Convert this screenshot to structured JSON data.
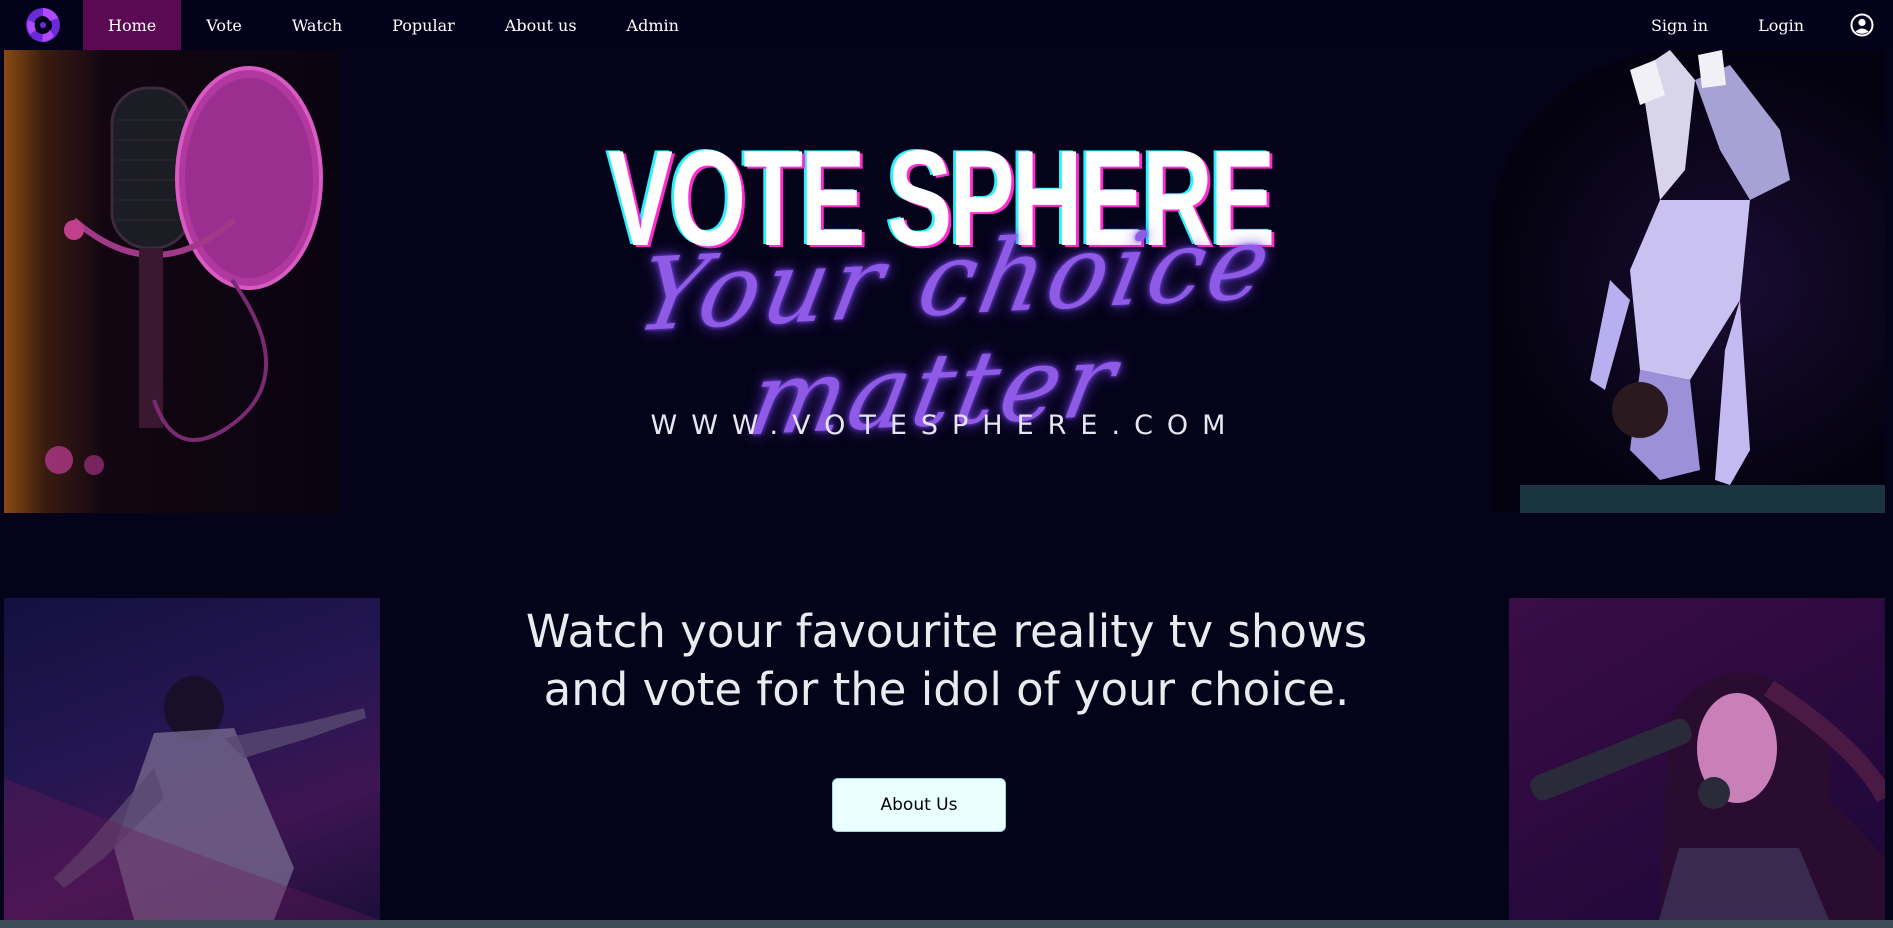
{
  "nav": {
    "logo_icon": "orb-logo-icon",
    "items": [
      {
        "label": "Home",
        "active": true
      },
      {
        "label": "Vote",
        "active": false
      },
      {
        "label": "Watch",
        "active": false
      },
      {
        "label": "Popular",
        "active": false
      },
      {
        "label": "About us",
        "active": false
      },
      {
        "label": "Admin",
        "active": false
      }
    ],
    "sign_in": "Sign in",
    "login": "Login",
    "user_icon": "user-circle-icon"
  },
  "hero": {
    "title": "VOTE SPHERE",
    "script": "Your choice matter",
    "url": "WWW.VOTESPHERE.COM"
  },
  "tagline": {
    "line1": "Watch your favourite reality tv shows",
    "line2": "and vote for the idol of your choice."
  },
  "about_button": "About Us",
  "colors": {
    "background": "#05031a",
    "nav_active": "#5a0a52",
    "script_purple": "#8f5ae6",
    "button_bg": "#eaffff"
  }
}
